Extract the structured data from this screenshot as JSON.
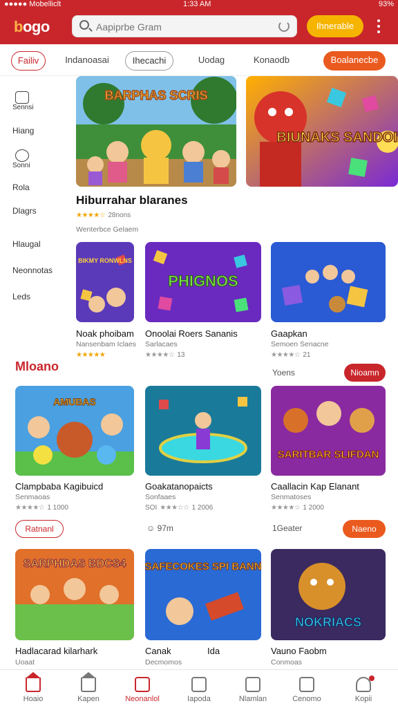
{
  "status_bar": {
    "carrier": "●●●●● Mobelliclt",
    "time": "1:33 AM",
    "battery": "93%"
  },
  "header": {
    "logo_part1": "b",
    "logo_part2": "ogo",
    "search_placeholder": "Aapiprbe Gram",
    "button_label": "Ihnerable"
  },
  "tabs": [
    "Failiv",
    "Indanoasai",
    "Ihecachi",
    "Uodag",
    "Konaodb",
    "Boalanecbe"
  ],
  "sidebar": [
    {
      "label": "Sennsi",
      "icon": "folder-icon"
    },
    {
      "label": "Hiang"
    },
    {
      "label": "Sonni",
      "icon": "clock-icon"
    },
    {
      "label": "Rola"
    },
    {
      "label": "Dlagrs"
    },
    {
      "label": "Hlaugal"
    },
    {
      "label": "Neonnotas"
    },
    {
      "label": "Leds"
    }
  ],
  "featured": {
    "title": "Hiburrahar blaranes",
    "stars": "★★★★☆",
    "rating_text": "28nons",
    "subtitle": "Wenterbce Gelaem",
    "banner1_text": "BARPHAS SCRIS",
    "banner2_text": "BIUNAKS SANDOIES"
  },
  "row1": [
    {
      "title": "Noak phoibam",
      "sub": "Nansenbam Iclaes",
      "stars": "★★★★★",
      "rating": "",
      "art": "BIKMY RONWLNS"
    },
    {
      "title": "Onoolai Roers Sananis",
      "sub": "Sarlacaes",
      "stars": "★★★★☆",
      "rating": "13",
      "art": "PHIGNOS"
    },
    {
      "title": "Gaapkan",
      "sub": "Semoen Senacne",
      "stars": "★★★★☆",
      "rating": "21",
      "art": ""
    }
  ],
  "section": {
    "title": "Mloano",
    "more_label": "Yoens",
    "chip_label": "Nioamn"
  },
  "row2": [
    {
      "title": "Clampbaba Kagibuicd",
      "sub": "Senmaoas",
      "stars": "★★★★☆",
      "rating": "1 1000",
      "art": "AMUBAS"
    },
    {
      "title": "Goakatanopaicts",
      "sub": "Sonfaaes",
      "stars": "★★★☆☆",
      "rating": "1 2006",
      "prefix": "SOI",
      "art": ""
    },
    {
      "title": "Caallacin Kap Elanant",
      "sub": "Senmatoses",
      "stars": "★★★★☆",
      "rating": "1 2000",
      "art": "SARITBAR SLIFDAN"
    }
  ],
  "actions": {
    "left_chip": "Ratnanl",
    "mid_text": "☺ 97m",
    "right_text": "1Geater",
    "right_chip": "Naeno"
  },
  "row3": [
    {
      "title": "Hadlacarad kilarhark",
      "sub": "Uoaat",
      "art": "SARPHDAS BDCS4"
    },
    {
      "title": "Canak",
      "title2": "Ida",
      "sub": "Decmomos",
      "art": "SAFECOKES SPI BANN"
    },
    {
      "title": "Vauno Faobm",
      "sub": "Conmoas",
      "art": "NOKRIACS"
    }
  ],
  "bottom_nav": [
    {
      "label": "Hoaio",
      "icon": "home-icon",
      "active": false
    },
    {
      "label": "Kapen",
      "icon": "house-outline-icon",
      "active": false
    },
    {
      "label": "Neonanlol",
      "icon": "list-icon",
      "active": true
    },
    {
      "label": "Iapoda",
      "icon": "tablet-icon",
      "active": false
    },
    {
      "label": "Nlamlan",
      "icon": "gift-icon",
      "active": false
    },
    {
      "label": "Cenomo",
      "icon": "edit-icon",
      "active": false
    },
    {
      "label": "Kopii",
      "icon": "person-icon",
      "active": false
    }
  ],
  "colors": {
    "brand_red": "#c8262b",
    "accent_orange": "#ea5a1f",
    "accent_yellow": "#f5b400"
  }
}
